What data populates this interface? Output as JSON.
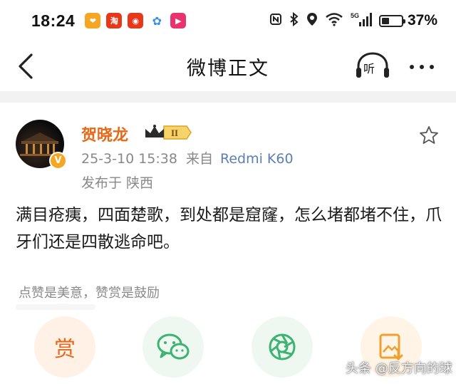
{
  "status_bar": {
    "time": "18:24",
    "app_icons": [
      {
        "name": "weibo-app-icon",
        "color": "#f5a623",
        "glyph": "❤"
      },
      {
        "name": "taobao-app-icon",
        "color": "#e8381a",
        "glyph": "淘"
      },
      {
        "name": "weibo-red-app-icon",
        "color": "#e8381a",
        "glyph": "◉"
      },
      {
        "name": "pinwheel-app-icon",
        "color": "#ffffff",
        "glyph": "✿"
      },
      {
        "name": "video-app-icon",
        "color": "#e8336e",
        "glyph": "▶"
      }
    ],
    "network": "5G",
    "battery_level": 0.37,
    "battery_percent": "37%"
  },
  "header": {
    "title": "微博正文",
    "listen_label": "听"
  },
  "post": {
    "author": "贺晓龙",
    "member_level": "II",
    "date": "25-3-10 15:38",
    "from_label": "来自",
    "device": "Redmi K60",
    "location": "发布于 陕西",
    "body": "满目疮痍，四面楚歌，到处都是窟窿，怎么堵都堵不住，爪牙们还是四散逃命吧。"
  },
  "reward_tip": "点赞是美意，赞赏是鼓励",
  "actions": {
    "reward_label": "赏"
  },
  "watermark": "头条 @反方向的球",
  "colors": {
    "accent_orange": "#e8681a",
    "link_blue": "#5b7fb0",
    "wechat_green": "#3cb371"
  }
}
